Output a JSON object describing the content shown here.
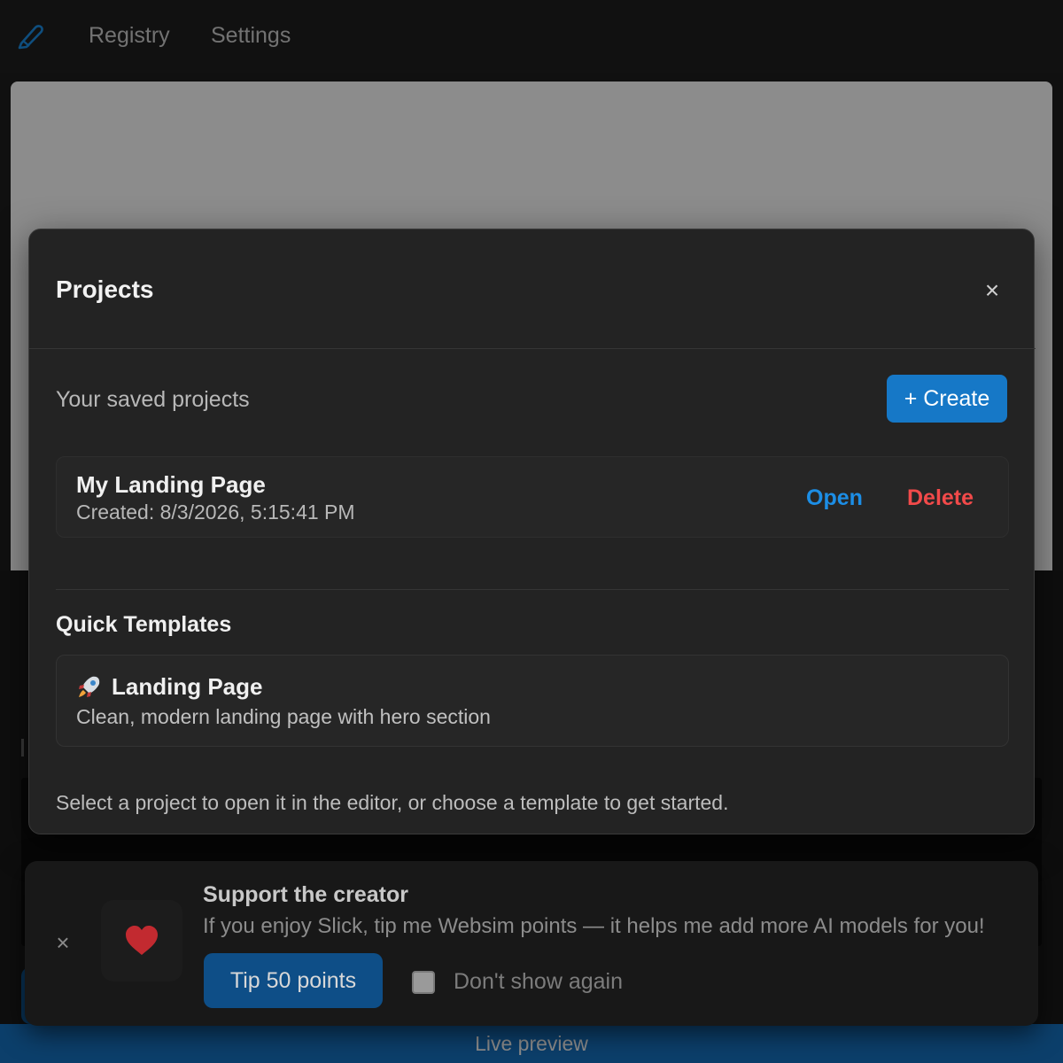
{
  "nav": {
    "logo_icon": "pen-icon",
    "items": [
      {
        "label": "Registry"
      },
      {
        "label": "Settings"
      }
    ]
  },
  "bottom_bar": {
    "label": "Live preview"
  },
  "modal": {
    "title": "Projects",
    "close_icon": "close-icon",
    "saved_label": "Your saved projects",
    "create_label": "+ Create",
    "projects": [
      {
        "name": "My Landing Page",
        "created": "Created: 8/3/2026, 5:15:41 PM",
        "open_label": "Open",
        "delete_label": "Delete"
      }
    ],
    "templates_title": "Quick Templates",
    "templates": [
      {
        "icon": "rocket-icon",
        "name": "Landing Page",
        "description": "Clean, modern landing page with hero section"
      }
    ],
    "hint": "Select a project to open it in the editor, or choose a template to get started."
  },
  "support": {
    "title": "Support the creator",
    "message": "If you enjoy Slick, tip me Websim points — it helps me add more AI models for you!",
    "tip_label": "Tip 50 points",
    "dont_show_label": "Don't show again",
    "heart_icon": "heart-icon",
    "close_icon": "close-icon"
  },
  "colors": {
    "accent": "#1678c7",
    "link": "#1c8ee6",
    "danger": "#f24a4a",
    "heart": "#d9262f"
  }
}
